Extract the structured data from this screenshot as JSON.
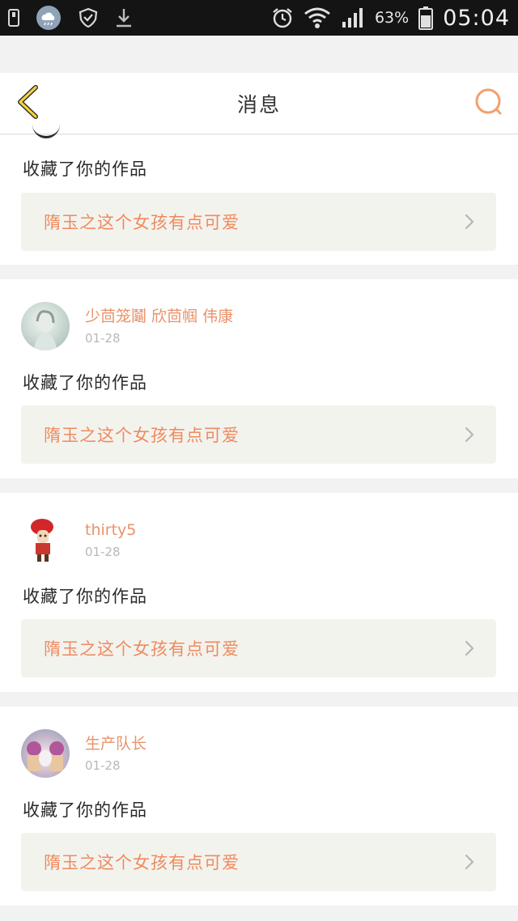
{
  "status_bar": {
    "left_icons": [
      "sim-icon",
      "weather-cloud-icon",
      "shield-icon",
      "download-icon"
    ],
    "battery_percent": "63%",
    "time": "05:04"
  },
  "header": {
    "title": "消息",
    "back_icon": "chevron-left-icon",
    "search_icon": "search-icon"
  },
  "colors": {
    "accent": "#ef8a5e",
    "username": "#e8926a",
    "back_icon": "#f2d43a",
    "work_box_bg": "#f3f3ee"
  },
  "feed": {
    "items": [
      {
        "action": "收藏了你的作品",
        "work_title": "隋玉之这个女孩有点可爱"
      },
      {
        "username": "少茴笼鬮 欣茴帼 伟康",
        "date": "01-28",
        "action": "收藏了你的作品",
        "work_title": "隋玉之这个女孩有点可爱"
      },
      {
        "username": "thirty5",
        "date": "01-28",
        "action": "收藏了你的作品",
        "work_title": "隋玉之这个女孩有点可爱"
      },
      {
        "username": "生产队长",
        "date": "01-28",
        "action": "收藏了你的作品",
        "work_title": "隋玉之这个女孩有点可爱"
      }
    ]
  }
}
